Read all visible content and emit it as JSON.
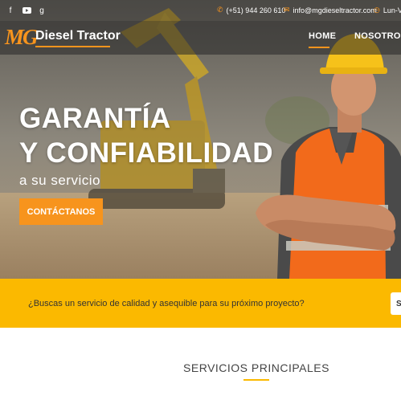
{
  "topbar": {
    "social": [
      {
        "name": "facebook-icon",
        "glyph": "f"
      },
      {
        "name": "youtube-icon",
        "glyph": "▶"
      },
      {
        "name": "google-plus-icon",
        "glyph": "g"
      }
    ],
    "phone": {
      "icon": "phone-icon",
      "text": "(+51) 944 260 610"
    },
    "email": {
      "icon": "mail-icon",
      "text": "info@mgdieseltractor.com"
    },
    "hours": {
      "icon": "clock-icon",
      "text": "Lun-V"
    }
  },
  "navbar": {
    "logo_mark": "MG",
    "logo_text": "Diesel Tractor",
    "items": [
      "HOME",
      "NOSOTROS"
    ],
    "active_index": 0
  },
  "hero": {
    "title_line1": "GARANTÍA",
    "title_line2": "Y CONFIABILIDAD",
    "subtitle": "a su servicio",
    "cta_label": "CONTÁCTANOS"
  },
  "banner": {
    "text": "¿Buscas un servicio de calidad y asequible para su próximo proyecto?",
    "button_label": "S"
  },
  "services": {
    "title": "SERVICIOS PRINCIPALES"
  },
  "colors": {
    "accent": "#f7941d",
    "banner": "#fbb900"
  }
}
